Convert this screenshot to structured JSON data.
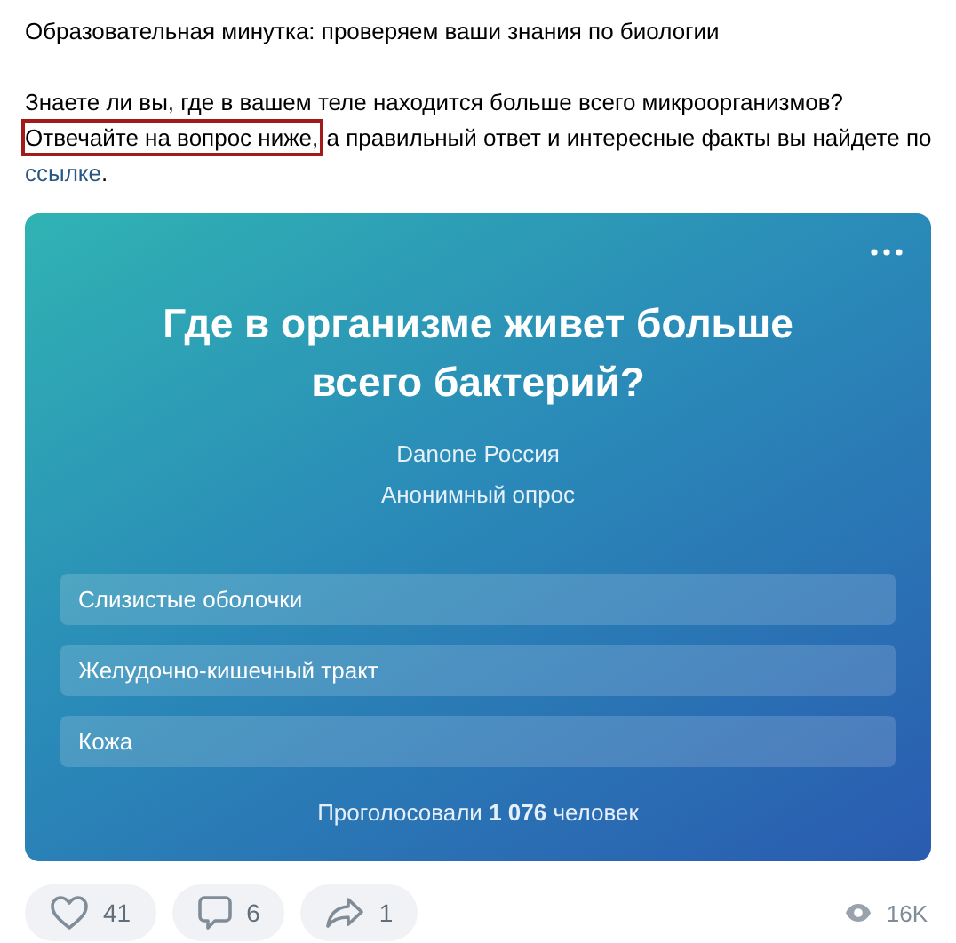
{
  "post": {
    "heading": "Образовательная минутка: проверяем ваши знания по биологии",
    "paragraph": [
      {
        "kind": "plain",
        "text": "Знаете ли вы, где в вашем теле находится больше всего микроорганизмов? "
      },
      {
        "kind": "highlight",
        "text": "Отвечайте на вопрос ниже,"
      },
      {
        "kind": "plain",
        "text": " а правильный ответ и интересные факты вы найдете по "
      },
      {
        "kind": "link",
        "text": "ссылке"
      },
      {
        "kind": "plain",
        "text": "."
      }
    ]
  },
  "poll": {
    "title": "Где в организме живет больше всего бактерий?",
    "author": "Danone Россия",
    "type": "Анонимный опрос",
    "options": [
      {
        "label": "Слизистые оболочки"
      },
      {
        "label": "Желудочно-кишечный тракт"
      },
      {
        "label": "Кожа"
      }
    ],
    "votes": "Проголосовали **1 076** человек"
  },
  "actions": [
    {
      "kind": "like",
      "count": "41"
    },
    {
      "kind": "comment",
      "count": "6"
    },
    {
      "kind": "share",
      "count": "1"
    }
  ],
  "views": "16K"
}
